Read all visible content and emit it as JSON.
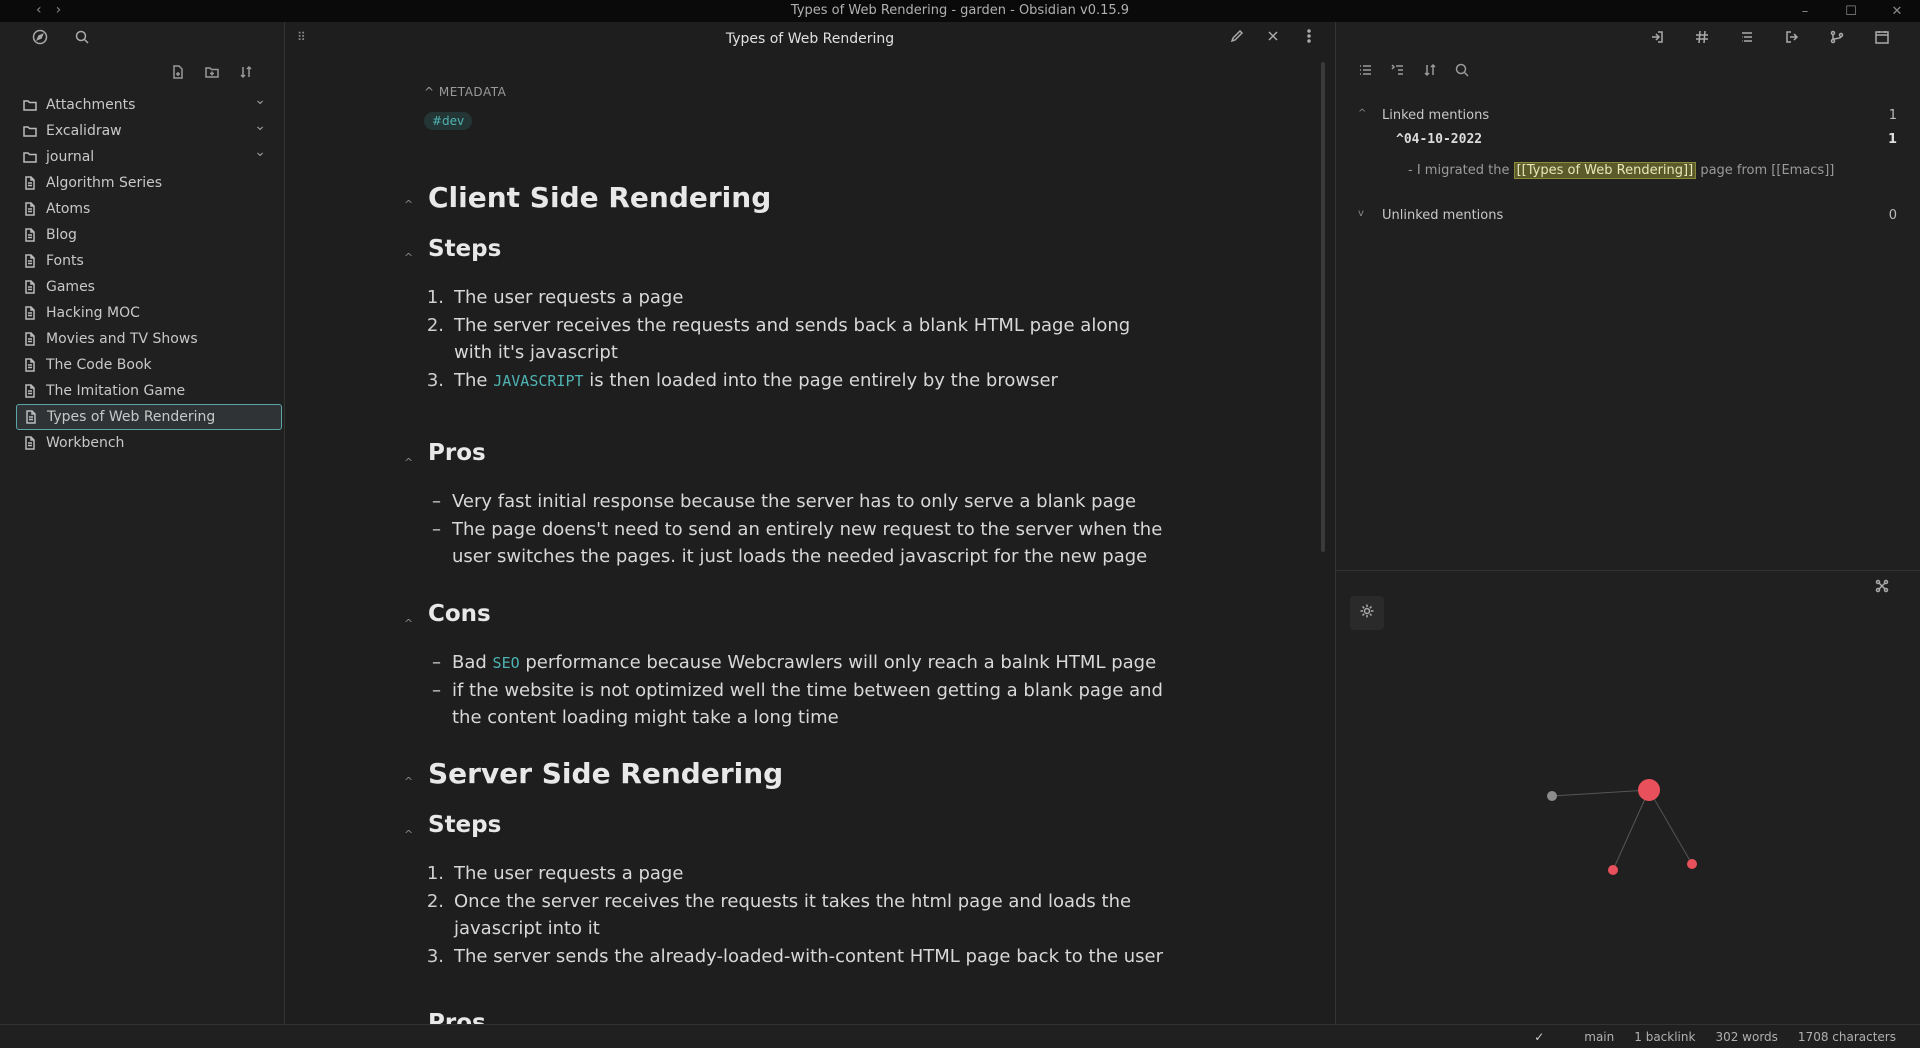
{
  "window": {
    "title": "Types of Web Rendering - garden - Obsidian v0.15.9"
  },
  "sidebar": {
    "items": [
      {
        "label": "Attachments",
        "type": "folder"
      },
      {
        "label": "Excalidraw",
        "type": "folder"
      },
      {
        "label": "journal",
        "type": "folder"
      },
      {
        "label": "Algorithm Series",
        "type": "file"
      },
      {
        "label": "Atoms",
        "type": "file"
      },
      {
        "label": "Blog",
        "type": "file"
      },
      {
        "label": "Fonts",
        "type": "file"
      },
      {
        "label": "Games",
        "type": "file"
      },
      {
        "label": "Hacking MOC",
        "type": "file"
      },
      {
        "label": "Movies and TV Shows",
        "type": "file"
      },
      {
        "label": "The Code Book",
        "type": "file"
      },
      {
        "label": "The Imitation Game",
        "type": "file"
      },
      {
        "label": "Types of Web Rendering",
        "type": "file",
        "active": true
      },
      {
        "label": "Workbench",
        "type": "file"
      }
    ]
  },
  "editor": {
    "tab_title": "Types of Web Rendering",
    "metadata_label": "METADATA",
    "tag": "#dev",
    "h_csr": "Client Side Rendering",
    "h_steps": "Steps",
    "h_pros": "Pros",
    "h_cons": "Cons",
    "h_ssr": "Server Side Rendering",
    "csr_steps": [
      "The user requests a page",
      "The server receives the requests and sends back a blank HTML page along with it's javascript",
      "is then loaded into the page entirely by the browser"
    ],
    "csr_step3_prefix": "The",
    "csr_step3_code": "JAVASCRIPT",
    "csr_pros": [
      "Very fast initial response because the server has to only serve a blank page",
      "The page doens't need to send an entirely new request to the server when the user switches the pages. it just loads the needed javascript for the new page"
    ],
    "csr_cons_1_prefix": "Bad",
    "csr_cons_1_code": "SEO",
    "csr_cons_1_suffix": "performance because Webcrawlers will only reach a balnk HTML page",
    "csr_cons_2": "if the website is not optimized well the time between getting a blank page and the content loading might take a long time",
    "ssr_steps": [
      "The user requests a page",
      "Once the server receives the requests it takes the html page and loads the javascript into it",
      "The server sends the already-loaded-with-content HTML page back to the user"
    ],
    "nums": [
      "1.",
      "2.",
      "3."
    ],
    "dash": "–"
  },
  "backlinks": {
    "linked_label": "Linked mentions",
    "linked_count": "1",
    "date": "04-10-2022",
    "date_count": "1",
    "snippet_prefix": "- I migrated the",
    "snippet_link": "[[Types of Web Rendering]]",
    "snippet_suffix": "page from [[Emacs]]",
    "unlinked_label": "Unlinked mentions",
    "unlinked_count": "0"
  },
  "status": {
    "branch": "main",
    "backlinks": "1 backlink",
    "words": "302 words",
    "chars": "1708 characters"
  },
  "colors": {
    "accent": "#4fb3b3",
    "graph_active": "#e8505b",
    "graph_node": "#8c8c8c"
  }
}
